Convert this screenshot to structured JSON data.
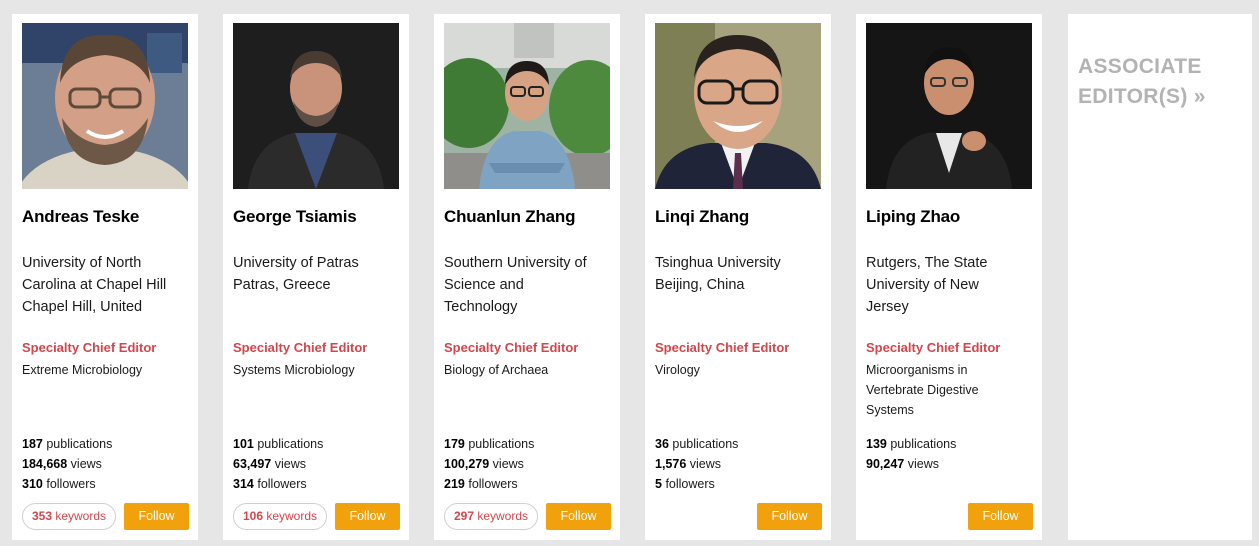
{
  "editors": [
    {
      "name": "Andreas Teske",
      "affiliation": [
        "University of North",
        "Carolina at Chapel Hill",
        "Chapel Hill, United"
      ],
      "role": "Specialty Chief Editor",
      "specialty": [
        "Extreme Microbiology"
      ],
      "publications": "187",
      "views": "184,668",
      "followers": "310",
      "keywords": "353",
      "photo_icon": "portrait-photo-andreas-teske"
    },
    {
      "name": "George Tsiamis",
      "affiliation": [
        "University of Patras",
        "Patras, Greece"
      ],
      "role": "Specialty Chief Editor",
      "specialty": [
        "Systems Microbiology"
      ],
      "publications": "101",
      "views": "63,497",
      "followers": "314",
      "keywords": "106",
      "photo_icon": "portrait-photo-george-tsiamis"
    },
    {
      "name": "Chuanlun Zhang",
      "affiliation": [
        "Southern University of",
        "Science and",
        "Technology"
      ],
      "role": "Specialty Chief Editor",
      "specialty": [
        "Biology of Archaea"
      ],
      "publications": "179",
      "views": "100,279",
      "followers": "219",
      "keywords": "297",
      "photo_icon": "portrait-photo-chuanlun-zhang"
    },
    {
      "name": "Linqi Zhang",
      "affiliation": [
        "Tsinghua University",
        "Beijing, China"
      ],
      "role": "Specialty Chief Editor",
      "specialty": [
        "Virology"
      ],
      "publications": "36",
      "views": "1,576",
      "followers": "5",
      "keywords": null,
      "photo_icon": "portrait-photo-linqi-zhang"
    },
    {
      "name": "Liping Zhao",
      "affiliation": [
        "Rutgers, The State",
        "University of New",
        "Jersey"
      ],
      "role": "Specialty Chief Editor",
      "specialty": [
        "Microorganisms in",
        "Vertebrate Digestive",
        "Systems"
      ],
      "publications": "139",
      "views": "90,247",
      "followers": null,
      "keywords": null,
      "photo_icon": "portrait-photo-liping-zhao"
    }
  ],
  "labels": {
    "publications": "publications",
    "views": "views",
    "followers": "followers",
    "keywords": "keywords",
    "follow": "Follow"
  },
  "associate": {
    "line1": "ASSOCIATE",
    "line2": "EDITOR(S) »"
  },
  "colors": {
    "accent_red": "#d2464c",
    "follow_orange": "#f0a10c",
    "muted_link": "#b3b3b3",
    "background": "#e6e6e6"
  }
}
